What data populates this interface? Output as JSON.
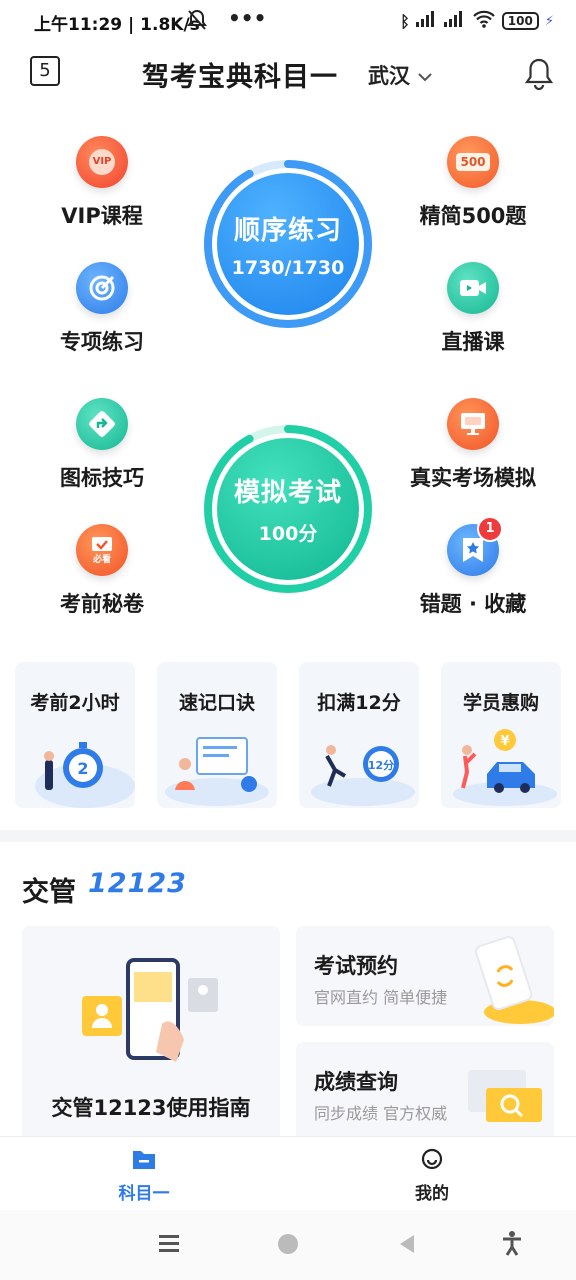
{
  "status_bar": {
    "time": "上午11:29 | 1.8K/s",
    "more": "•••",
    "battery": "100"
  },
  "header": {
    "calendar_day": "5",
    "title": "驾考宝典科目一",
    "city": "武汉"
  },
  "features": {
    "vip": "VIP课程",
    "vip_icon_text": "VIP",
    "special": "专项练习",
    "icon_tips": "图标技巧",
    "secret": "考前秘卷",
    "secret_icon_text": "必看",
    "simple500": "精简500题",
    "simple500_icon_text": "500",
    "live": "直播课",
    "real_exam": "真实考场模拟",
    "wrong_fav": "错题 · 收藏",
    "wrong_badge": "1"
  },
  "practice": {
    "label": "顺序练习",
    "progress_text": "1730/1730",
    "progress": 0.92
  },
  "mock": {
    "label": "模拟考试",
    "score_text": "100分",
    "progress": 0.92
  },
  "cards": [
    {
      "title": "考前2小时",
      "art_text": "2"
    },
    {
      "title": "速记口诀"
    },
    {
      "title": "扣满12分",
      "art_text": "12分"
    },
    {
      "title": "学员惠购",
      "art_text": "¥"
    }
  ],
  "section": {
    "title": "交管",
    "number": "12123"
  },
  "guide": {
    "title": "交管12123使用指南"
  },
  "exam_booking": {
    "title": "考试预约",
    "subtitle": "官网直约 简单便捷"
  },
  "score_query": {
    "title": "成绩查询",
    "subtitle": "同步成绩 官方权威"
  },
  "bottom_nav": [
    {
      "label": "科目一",
      "active": true
    },
    {
      "label": "我的",
      "active": false
    }
  ],
  "colors": {
    "accent": "#2f7be8",
    "green": "#1ec9a8",
    "orange": "#ff7a30"
  }
}
